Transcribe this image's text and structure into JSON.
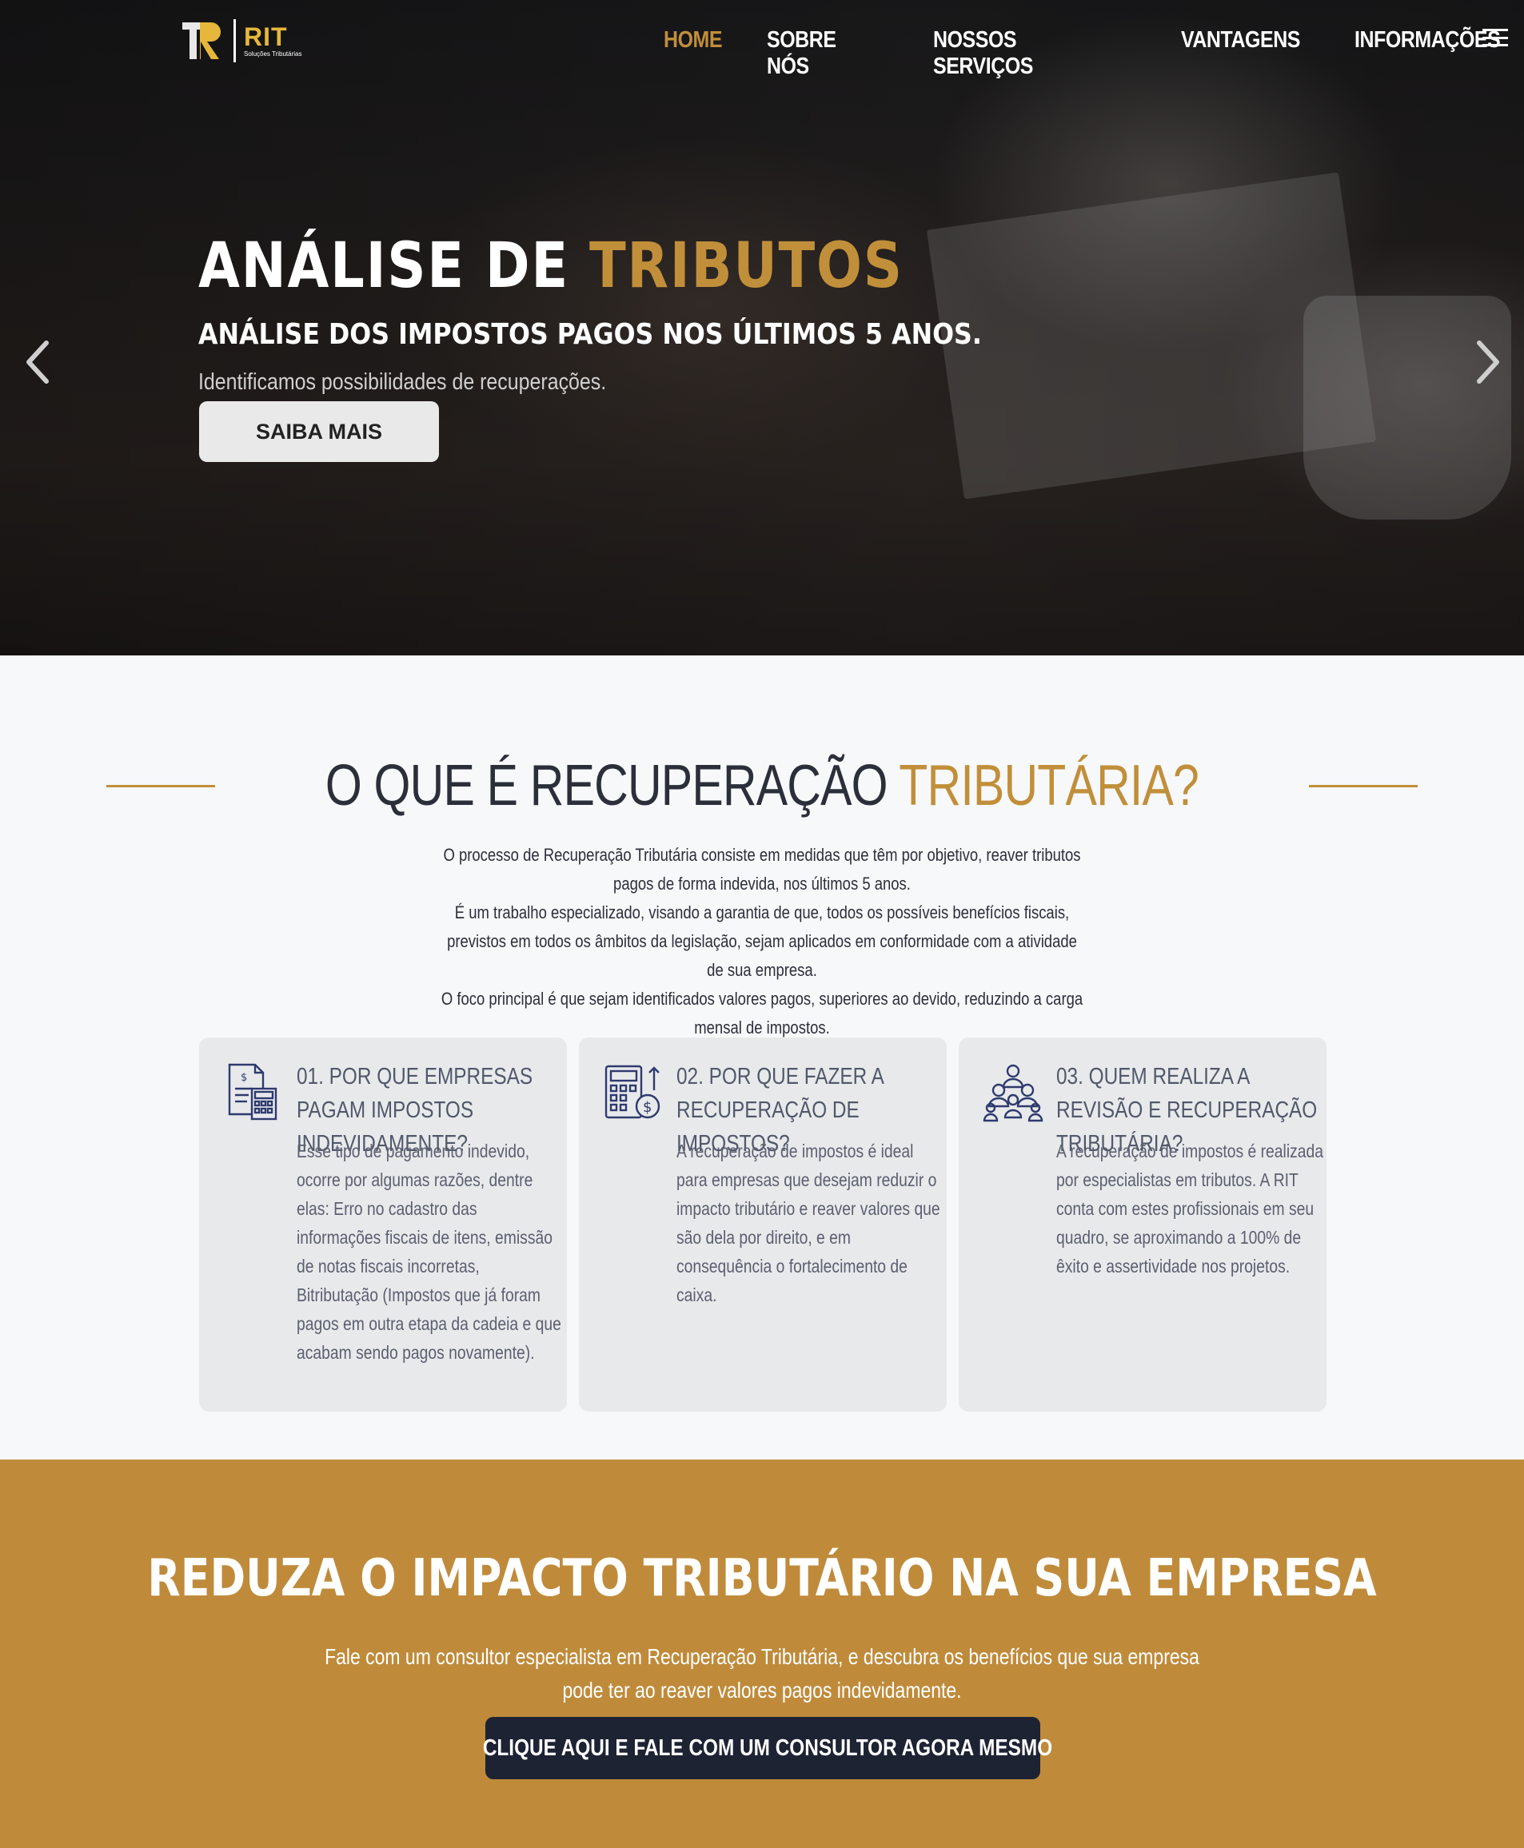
{
  "brand": {
    "name": "RIT",
    "tagline": "Soluções Tributárias",
    "accent_color": "#c18f3a",
    "logo_color": "#e6b73a"
  },
  "nav": {
    "items": [
      {
        "label": "HOME",
        "active": true
      },
      {
        "label": "SOBRE NÓS",
        "active": false
      },
      {
        "label": "NOSSOS SERVIÇOS",
        "active": false
      },
      {
        "label": "VANTAGENS",
        "active": false
      },
      {
        "label": "INFORMAÇÕES",
        "active": false
      }
    ],
    "menu_icon": "hamburger-icon"
  },
  "hero": {
    "title_main": "ANÁLISE DE ",
    "title_accent": "TRIBUTOS",
    "subtitle": "ANÁLISE DOS IMPOSTOS PAGOS NOS ÚLTIMOS 5 ANOS.",
    "description": "Identificamos possibilidades de recuperações.",
    "button_label": "SAIBA MAIS",
    "prev_icon": "chevron-left-icon",
    "next_icon": "chevron-right-icon"
  },
  "about": {
    "heading_main": "O QUE É RECUPERAÇÃO ",
    "heading_accent": "TRIBUTÁRIA?",
    "paragraphs": [
      "O processo de Recuperação Tributária consiste em medidas que têm por objetivo, reaver tributos pagos de forma indevida, nos últimos 5 anos.",
      "É um trabalho especializado, visando a garantia de que, todos os possíveis benefícios fiscais, previstos em todos os âmbitos da legislação, sejam aplicados em conformidade com a atividade de sua empresa.",
      "O foco principal é que sejam identificados valores pagos, superiores ao devido, reduzindo a carga mensal de impostos."
    ],
    "cards": [
      {
        "icon": "invoice-calculator-icon",
        "title": "01. POR QUE EMPRESAS PAGAM IMPOSTOS INDEVIDAMENTE?",
        "text": "Esse tipo de pagamento indevido, ocorre por algumas razões, dentre elas: Erro no cadastro das informações fiscais de itens, emissão de notas fiscais incorretas, Bitributação (Impostos que já foram pagos em outra etapa da cadeia e que acabam sendo pagos novamente)."
      },
      {
        "icon": "calculator-money-icon",
        "title": "02. POR QUE FAZER A RECUPERAÇÃO DE IMPOSTOS?",
        "text": "A recuperação de impostos é ideal para empresas que desejam reduzir o impacto tributário e reaver valores que são dela por direito, e em consequência o fortalecimento de caixa."
      },
      {
        "icon": "team-people-icon",
        "title": "03. QUEM REALIZA A REVISÃO E RECUPERAÇÃO TRIBUTÁRIA?",
        "text": "A recuperação de impostos é realizada por especialistas em tributos. A RIT conta com estes profissionais em seu quadro, se aproximando a 100% de êxito e assertividade nos projetos."
      }
    ]
  },
  "cta": {
    "title": "REDUZA O IMPACTO TRIBUTÁRIO NA SUA EMPRESA",
    "text": "Fale com um consultor especialista em Recuperação Tributária, e descubra os benefícios que sua empresa pode ter ao reaver valores pagos indevidamente.",
    "button_label": "CLIQUE AQUI E FALE COM UM CONSULTOR AGORA MESMO",
    "button_icon": "whatsapp-icon",
    "background_color": "#bf8b3b",
    "button_color": "#1d2333"
  }
}
